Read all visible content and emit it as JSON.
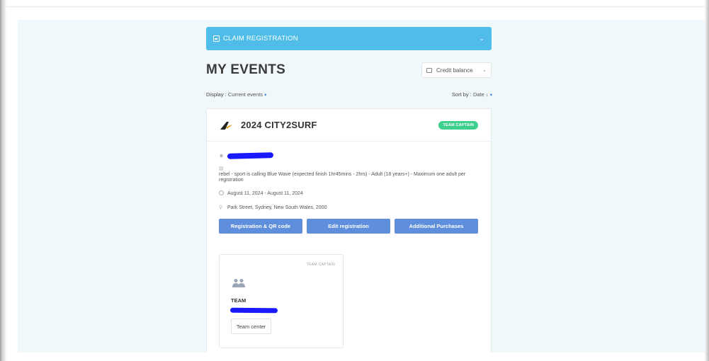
{
  "claim_bar": {
    "label": "CLAIM REGISTRATION",
    "icon": "edit-icon",
    "chevron": "⌄"
  },
  "page": {
    "title": "MY EVENTS"
  },
  "credit": {
    "label": "Credit balance",
    "icon": "wallet-icon",
    "chevron": "⌄"
  },
  "filters": {
    "display_label": "Display :",
    "display_value": "Current events",
    "display_caret": "▾",
    "sort_label": "Sort by :",
    "sort_value": "Date ↓",
    "sort_caret": "▾"
  },
  "event": {
    "name": "2024 CITY2SURF",
    "role_badge": "TEAM CAPTAIN",
    "ticket": "rebel - sport is calling Blue Wave (expected finish 1hr45mins - 2hrs) - Adult (18 years+) - Maximum one adult per registration",
    "dates": "August 11, 2024 - August 11, 2024",
    "location": "Park Street, Sydney, New South Wales, 2000",
    "buttons": {
      "registration": "Registration & QR code",
      "edit": "Edit registration",
      "purchases": "Additional Purchases"
    }
  },
  "team_card": {
    "badge": "TEAM CAPTAIN",
    "label": "TEAM",
    "button": "Team center",
    "icon": "team-icon"
  },
  "colors": {
    "claim_bar": "#4fbde8",
    "primary_button": "#5f8fdc",
    "captain_badge": "#3fcf8e",
    "page_background": "#f1f8fc"
  }
}
